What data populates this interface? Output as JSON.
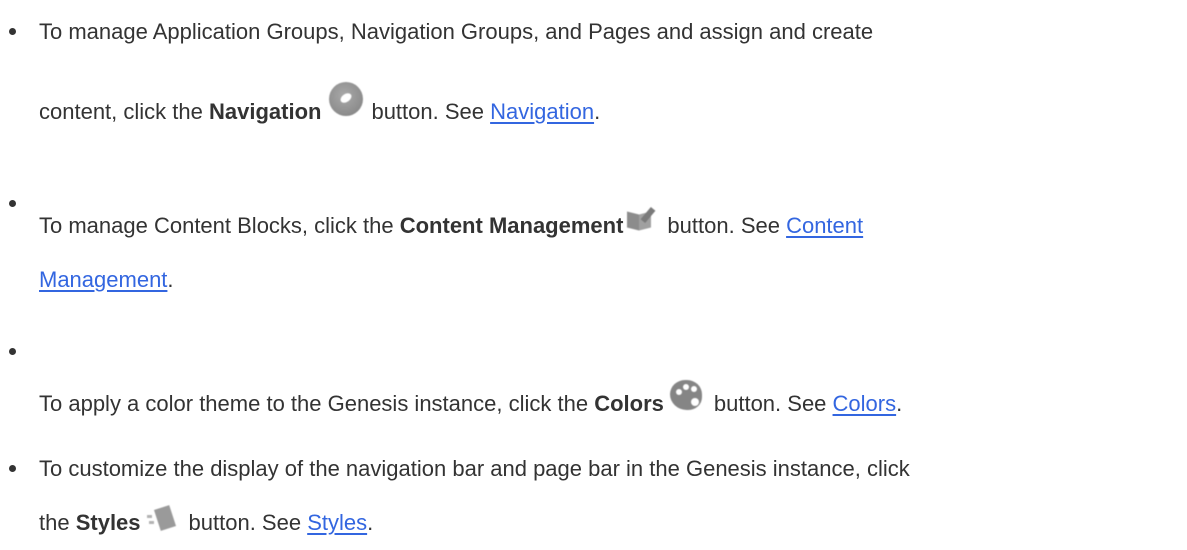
{
  "items": [
    {
      "line1": "To manage Application Groups, Navigation Groups, and Pages and assign and create",
      "line2_before": "content, click the ",
      "bold": "Navigation",
      "icon": "compass-icon",
      "after_icon": "button. See ",
      "link": "Navigation",
      "end": "."
    },
    {
      "before": "To manage Content Blocks, click the ",
      "bold": "Content Management",
      "icon": "content-management-icon",
      "after_icon": "button. See ",
      "link_part1": "Content",
      "link_part2": "Management",
      "end": "."
    },
    {
      "before": "To apply a color theme to the Genesis instance, click the ",
      "bold": "Colors",
      "icon": "palette-icon",
      "after_icon": "button. See ",
      "link": "Colors",
      "end": "."
    },
    {
      "line1": "To customize the display of the navigation bar and page bar in the Genesis instance, click",
      "line2_before": "the ",
      "bold": "Styles",
      "icon": "styles-icon",
      "after_icon": "button. See ",
      "link": "Styles",
      "end": "."
    }
  ],
  "colors": {
    "text": "#333333",
    "link": "#3366e0",
    "icon_gray": "#8c8c8c"
  }
}
